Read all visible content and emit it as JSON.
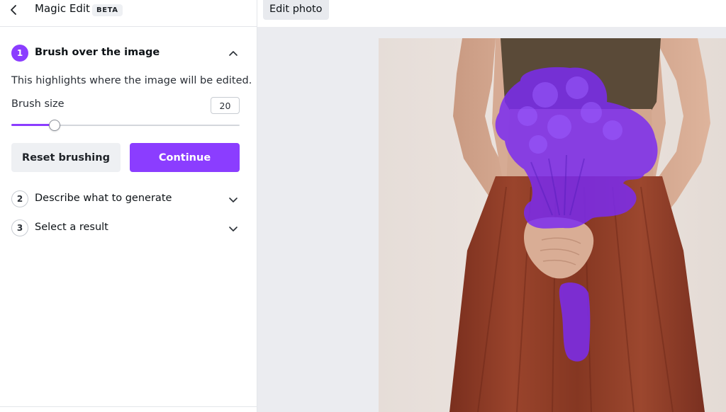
{
  "header": {
    "title": "Magic Edit",
    "badge": "BETA"
  },
  "steps": [
    {
      "number": "1",
      "title": "Brush over the image",
      "expanded": true
    },
    {
      "number": "2",
      "title": "Describe what to generate",
      "expanded": false
    },
    {
      "number": "3",
      "title": "Select a result",
      "expanded": false
    }
  ],
  "step1": {
    "description": "This highlights where the image will be edited.",
    "brush_label": "Brush size",
    "brush_value": "20",
    "reset_label": "Reset brushing",
    "continue_label": "Continue"
  },
  "canvas": {
    "edit_photo_label": "Edit photo"
  },
  "colors": {
    "accent": "#8b3dff",
    "mask": "#7a2cf0",
    "skirt": "#8a3a26",
    "top": "#5a4a38",
    "wall": "#e9e2dd"
  },
  "icons": {
    "back": "chevron-left-icon",
    "collapse": "chevron-up-icon",
    "expand": "chevron-down-icon"
  }
}
